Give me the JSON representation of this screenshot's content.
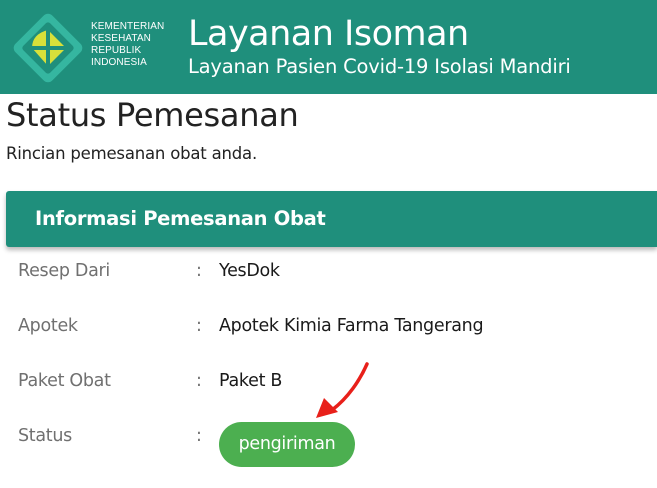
{
  "header": {
    "ministry_lines": [
      "KEMENTERIAN",
      "KESEHATAN",
      "REPUBLIK",
      "INDONESIA"
    ],
    "title": "Layanan Isoman",
    "subtitle": "Layanan Pasien Covid-19 Isolasi Mandiri",
    "logo_icon": "kemenkes-logo-icon"
  },
  "page": {
    "title": "Status Pemesanan",
    "subtitle": "Rincian pemesanan obat anda."
  },
  "card": {
    "title": "Informasi Pemesanan Obat",
    "rows": [
      {
        "label": "Resep Dari",
        "separator": ":",
        "value": "YesDok"
      },
      {
        "label": "Apotek",
        "separator": ":",
        "value": "Apotek Kimia Farma Tangerang"
      },
      {
        "label": "Paket Obat",
        "separator": ":",
        "value": "Paket B"
      },
      {
        "label": "Status",
        "separator": ":",
        "value": "pengiriman"
      }
    ]
  },
  "colors": {
    "brand_teal": "#1f8f7c",
    "logo_yellow": "#d7e03a",
    "logo_teal": "#35b6a0",
    "status_green": "#4caf50",
    "annotation_arrow": "#e8201a"
  },
  "annotation": {
    "icon": "red-arrow-icon"
  }
}
